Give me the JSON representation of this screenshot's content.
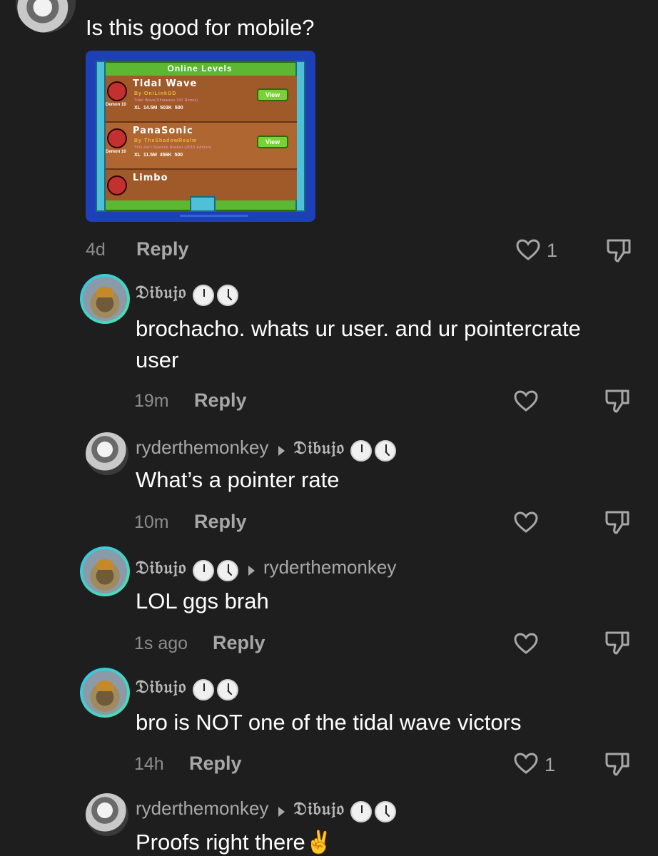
{
  "top_comment": {
    "text": "Is this good for mobile?",
    "time": "4d",
    "reply_label": "Reply",
    "likes": "1",
    "image": {
      "header": "Online Levels",
      "levels": [
        {
          "title": "Tidal Wave",
          "by": "By OniLinkGD",
          "song": "Tidal Wave(Shiawase VIP Remix)",
          "difficulty": "Demon",
          "stars": "10",
          "stats": [
            "XL",
            "14.5M",
            "503K",
            "500"
          ],
          "button": "View"
        },
        {
          "title": "PanaSonic",
          "by": "By TheShadowRealm",
          "song": "This Isn't Science Rocket (2015 Edition)",
          "difficulty": "Demon",
          "stars": "10",
          "stats": [
            "XL",
            "11.5M",
            "456K",
            "500"
          ],
          "button": "View"
        },
        {
          "title": "Limbo",
          "by": "",
          "song": "",
          "difficulty": "",
          "stars": "",
          "stats": [],
          "button": ""
        }
      ]
    }
  },
  "replies": [
    {
      "user": "𝔇𝔦𝔟𝔲𝔧𝔬",
      "reply_to": "",
      "text_lines": [
        "brochacho. whats ur user. and ur pointercrate",
        "user"
      ],
      "time": "19m",
      "reply_label": "Reply",
      "likes": ""
    },
    {
      "user": "ryderthemonkey",
      "reply_to": "𝔇𝔦𝔟𝔲𝔧𝔬",
      "text_lines": [
        "What’s a pointer rate"
      ],
      "time": "10m",
      "reply_label": "Reply",
      "likes": ""
    },
    {
      "user": "𝔇𝔦𝔟𝔲𝔧𝔬",
      "reply_to": "ryderthemonkey",
      "text_lines": [
        "LOL ggs brah"
      ],
      "time": "1s ago",
      "reply_label": "Reply",
      "likes": ""
    },
    {
      "user": "𝔇𝔦𝔟𝔲𝔧𝔬",
      "reply_to": "",
      "text_lines": [
        "bro is NOT one of the tidal wave victors"
      ],
      "time": "14h",
      "reply_label": "Reply",
      "likes": "1"
    },
    {
      "user": "ryderthemonkey",
      "reply_to": "𝔇𝔦𝔟𝔲𝔧𝔬",
      "text_lines": [
        "Proofs right there✌️"
      ],
      "time": "",
      "reply_label": "",
      "likes": ""
    }
  ],
  "icons": {
    "like": "heart-outline-icon",
    "dislike": "thumbs-down-icon",
    "badge": "clock-emoji-icon",
    "arrow": "reply-arrow-icon"
  }
}
